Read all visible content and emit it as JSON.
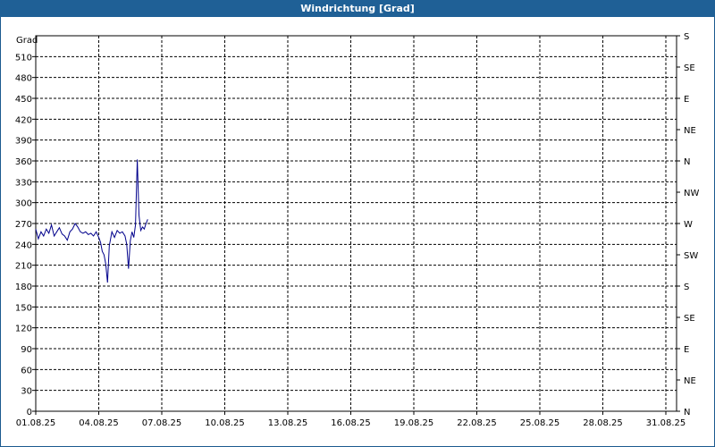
{
  "window": {
    "title": "Windrichtung [Grad]"
  },
  "chart_data": {
    "type": "line",
    "title": "Windrichtung [Grad]",
    "ylabel": "Grad",
    "ylim": [
      0,
      540
    ],
    "yticks": [
      0,
      30,
      60,
      90,
      120,
      150,
      180,
      210,
      240,
      270,
      300,
      330,
      360,
      390,
      420,
      450,
      480,
      510
    ],
    "xlim": [
      "01.08.25",
      "02.09.25"
    ],
    "xticks": [
      "01.08.25",
      "04.08.25",
      "07.08.25",
      "10.08.25",
      "13.08.25",
      "16.08.25",
      "19.08.25",
      "22.08.25",
      "25.08.25",
      "28.08.25",
      "31.08.25"
    ],
    "right_axis_labels": [
      "N",
      "NE",
      "E",
      "SE",
      "S",
      "SW",
      "W",
      "NW",
      "N",
      "NE",
      "E",
      "SE",
      "S"
    ],
    "grid": true,
    "line_color": "#00008b",
    "series": [
      {
        "x": [
          "01.08.25 00:00",
          "01.08.25 03:00",
          "01.08.25 06:00",
          "01.08.25 09:00",
          "01.08.25 12:00",
          "01.08.25 15:00",
          "01.08.25 18:00",
          "01.08.25 21:00",
          "02.08.25 00:00",
          "02.08.25 03:00",
          "02.08.25 06:00",
          "02.08.25 09:00",
          "02.08.25 12:00",
          "02.08.25 15:00",
          "02.08.25 18:00",
          "02.08.25 21:00",
          "03.08.25 00:00",
          "03.08.25 03:00",
          "03.08.25 06:00",
          "03.08.25 09:00",
          "03.08.25 12:00",
          "03.08.25 15:00",
          "03.08.25 18:00",
          "03.08.25 21:00",
          "04.08.25 00:00",
          "04.08.25 02:00",
          "04.08.25 04:00",
          "04.08.25 06:00",
          "04.08.25 08:00",
          "04.08.25 10:00",
          "04.08.25 12:00",
          "04.08.25 15:00",
          "04.08.25 18:00",
          "04.08.25 21:00",
          "05.08.25 00:00",
          "05.08.25 03:00",
          "05.08.25 06:00",
          "05.08.25 08:00",
          "05.08.25 10:00",
          "05.08.25 12:00",
          "05.08.25 14:00",
          "05.08.25 16:00",
          "05.08.25 18:00",
          "05.08.25 20:00",
          "05.08.25 22:00",
          "06.08.25 00:00",
          "06.08.25 02:00",
          "06.08.25 04:00",
          "06.08.25 06:00",
          "06.08.25 08:00"
        ],
        "values": [
          262,
          248,
          258,
          252,
          262,
          256,
          268,
          252,
          258,
          264,
          255,
          252,
          246,
          258,
          262,
          270,
          265,
          258,
          256,
          258,
          254,
          256,
          252,
          258,
          250,
          243,
          230,
          225,
          212,
          185,
          238,
          258,
          250,
          260,
          256,
          258,
          252,
          240,
          205,
          245,
          258,
          250,
          268,
          362,
          282,
          260,
          265,
          262,
          270,
          276
        ]
      }
    ]
  }
}
